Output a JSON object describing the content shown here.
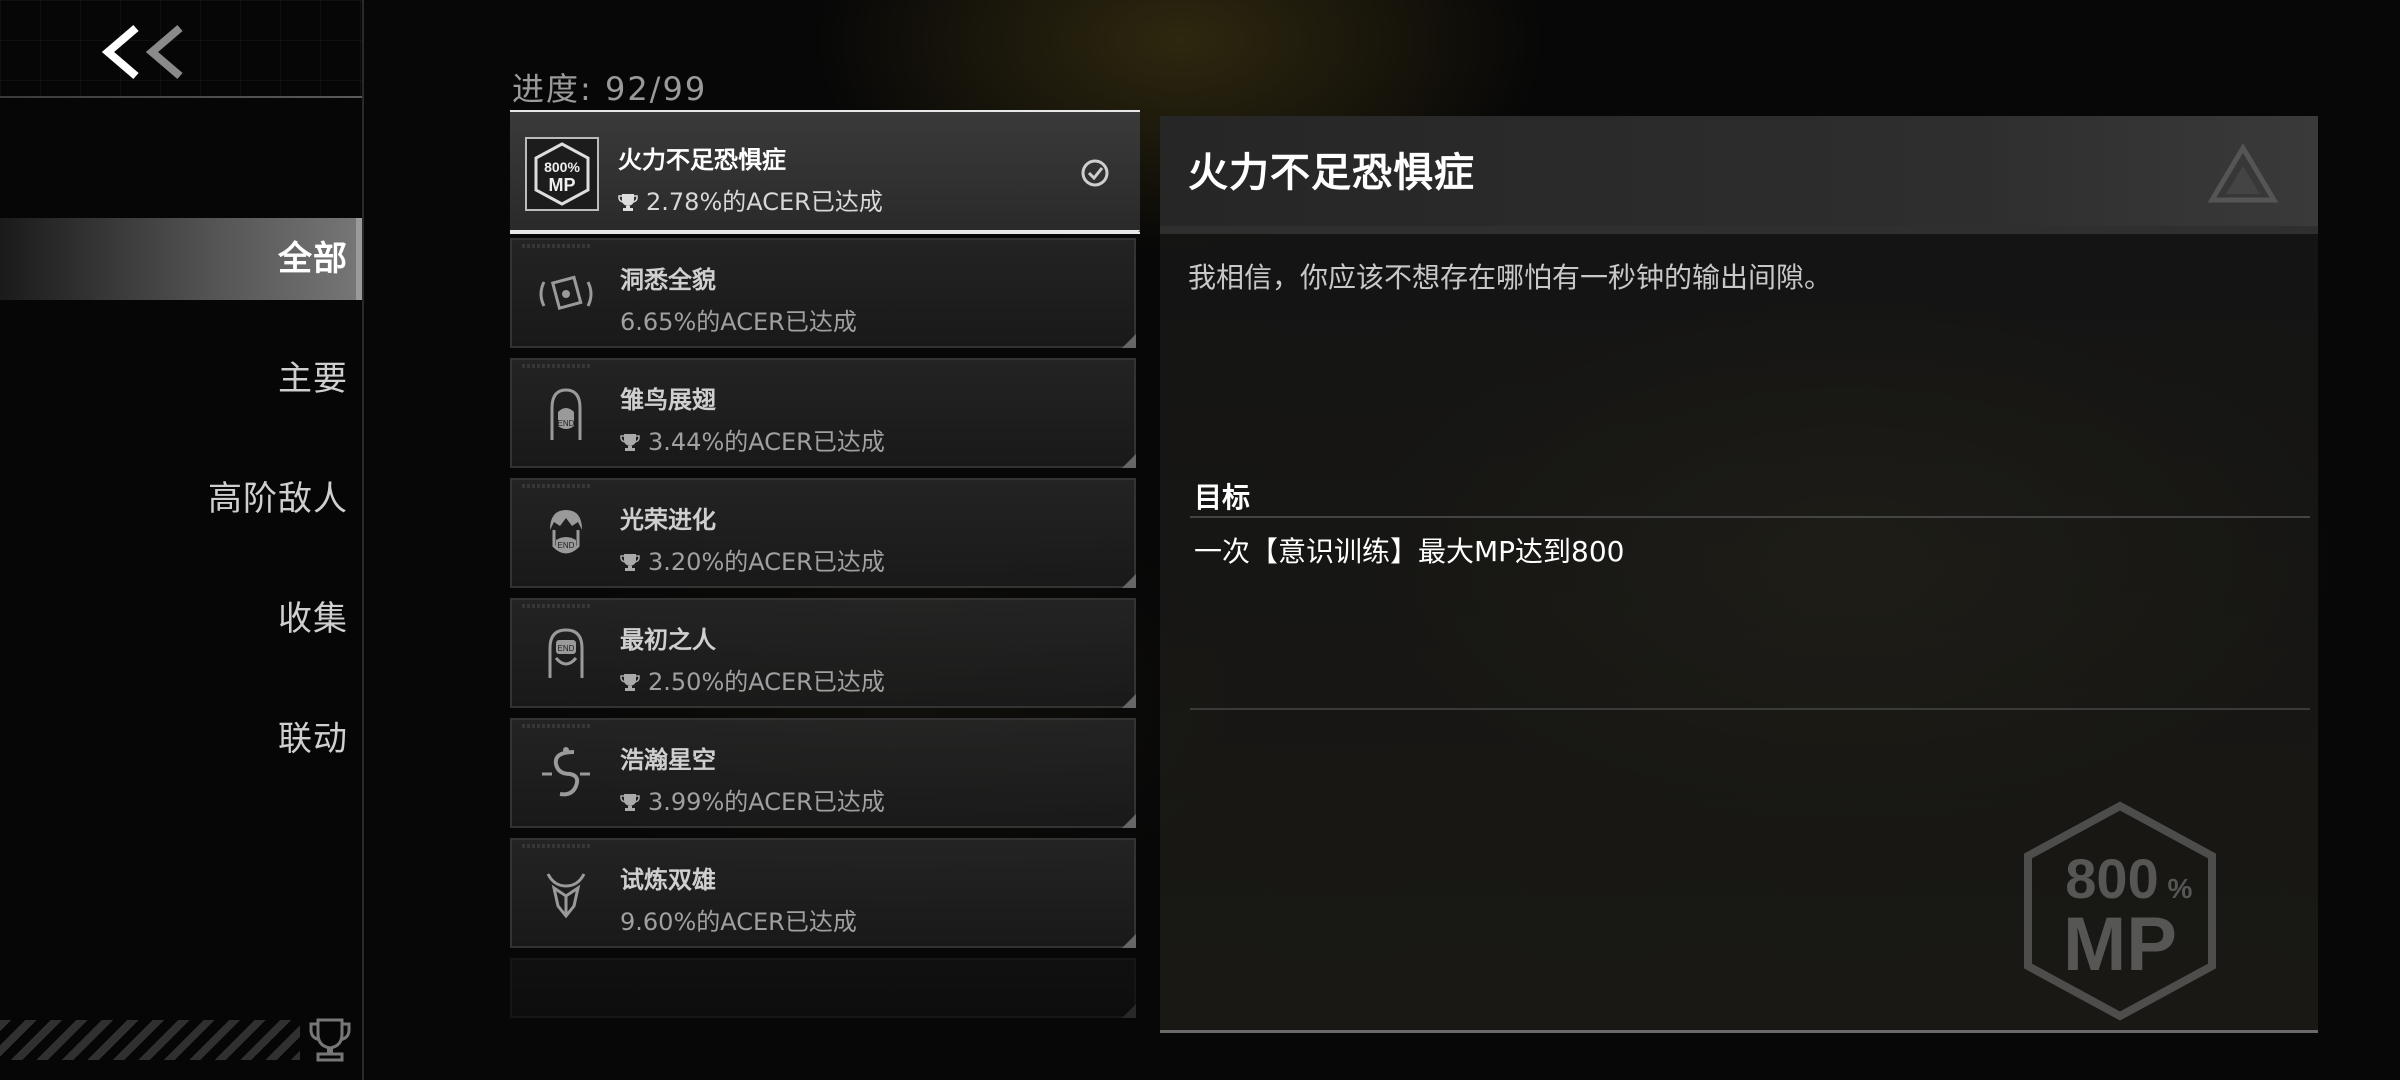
{
  "sidebar": {
    "back_label": "<<",
    "items": [
      {
        "label": "全部",
        "active": true
      },
      {
        "label": "主要",
        "active": false
      },
      {
        "label": "高阶敌人",
        "active": false
      },
      {
        "label": "收集",
        "active": false
      },
      {
        "label": "联动",
        "active": false
      }
    ]
  },
  "progress": {
    "text": "进度: 92/99"
  },
  "achievements": [
    {
      "title": "火力不足恐惧症",
      "rate": "2.78%的ACER已达成",
      "icon": "800-mp-badge-icon",
      "selected": true,
      "completed": true,
      "trophy": true
    },
    {
      "title": "洞悉全貌",
      "rate": "6.65%的ACER已达成",
      "icon": "eye-card-icon",
      "selected": false,
      "completed": false,
      "trophy": false
    },
    {
      "title": "雏鸟展翅",
      "rate": "3.44%的ACER已达成",
      "icon": "girl-portrait-icon",
      "selected": false,
      "completed": false,
      "trophy": true
    },
    {
      "title": "光荣进化",
      "rate": "3.20%的ACER已达成",
      "icon": "boy-portrait-icon",
      "selected": false,
      "completed": false,
      "trophy": true
    },
    {
      "title": "最初之人",
      "rate": "2.50%的ACER已达成",
      "icon": "masked-girl-icon",
      "selected": false,
      "completed": false,
      "trophy": true
    },
    {
      "title": "浩瀚星空",
      "rate": "3.99%的ACER已达成",
      "icon": "serpent-symbol-icon",
      "selected": false,
      "completed": false,
      "trophy": true
    },
    {
      "title": "试炼双雄",
      "rate": "9.60%的ACER已达成",
      "icon": "twin-emblem-icon",
      "selected": false,
      "completed": false,
      "trophy": false
    }
  ],
  "detail": {
    "title": "火力不足恐惧症",
    "description": "我相信，你应该不想存在哪怕有一秒钟的输出间隙。",
    "goal_label": "目标",
    "goal_text": "一次【意识训练】最大MP达到800",
    "badge_top": "800",
    "badge_pct": "%",
    "badge_bottom": "MP"
  },
  "colors": {
    "accent": "#e8e8e8",
    "background": "#070707",
    "panel": "#262626"
  }
}
